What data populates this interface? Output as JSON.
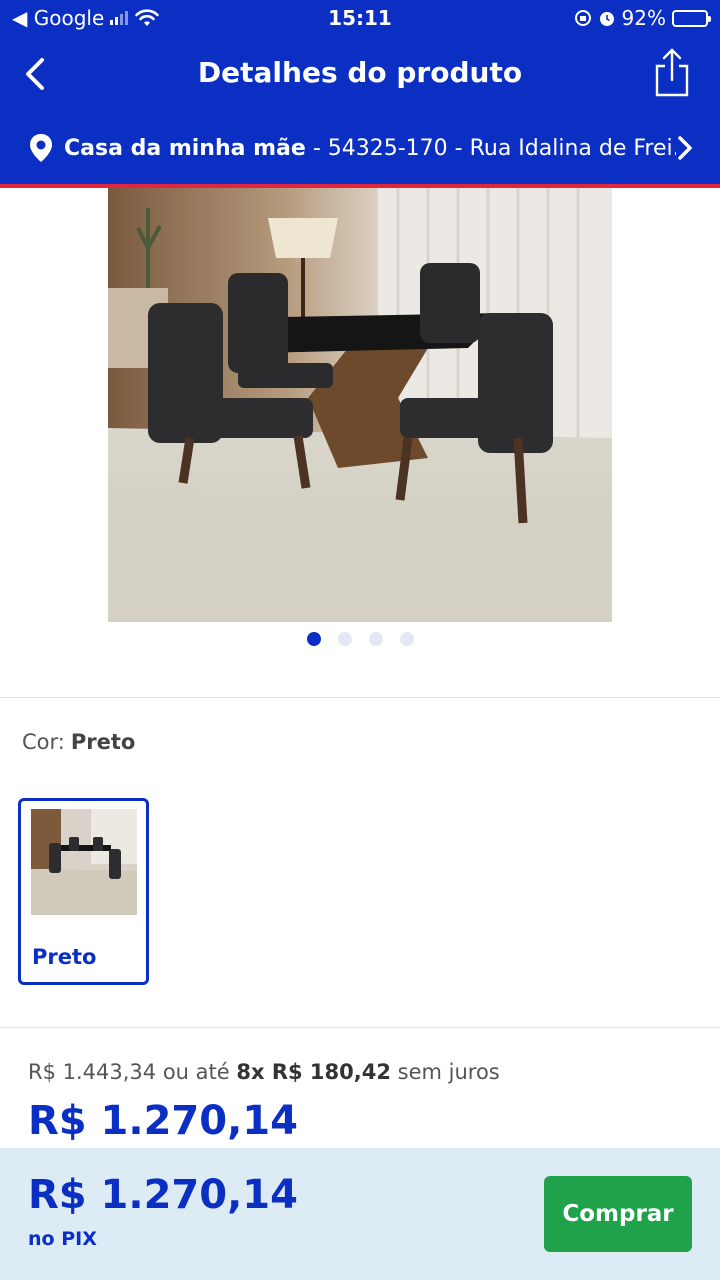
{
  "status_bar": {
    "back_app": "◀ Google",
    "time": "15:11",
    "battery_percent": "92%",
    "battery_level": 0.92,
    "icons": [
      "signal-icon",
      "wifi-icon",
      "orientation-lock-icon",
      "alarm-icon",
      "battery-icon"
    ]
  },
  "header": {
    "title": "Detalhes do produto",
    "icons": [
      "back-arrow-icon",
      "share-icon"
    ]
  },
  "address": {
    "label": "Casa da minha mãe",
    "details": " - 54325-170 - Rua Idalina de Frei...",
    "icons": [
      "location-pin-icon",
      "chevron-right-icon"
    ]
  },
  "gallery": {
    "image": "dining-table-with-four-chairs",
    "total_images": 4,
    "active_index": 0
  },
  "variant": {
    "label": "Cor:",
    "selected": "Preto",
    "options": [
      {
        "name": "Preto",
        "selected": true
      }
    ]
  },
  "pricing": {
    "original_text": "R$ 1.443,34 ou até ",
    "installments_count": "8x R$ 180,42",
    "installments_suffix": " sem juros",
    "price": "R$ 1.270,14"
  },
  "footer": {
    "pix_price": "R$ 1.270,14",
    "pix_label": "no PIX",
    "buy_label": "Comprar"
  },
  "colors": {
    "brand_blue": "#0a2fc2",
    "accent_red": "#e2263b",
    "buy_green": "#1fa24a",
    "footer_bg": "#dcebf4"
  }
}
